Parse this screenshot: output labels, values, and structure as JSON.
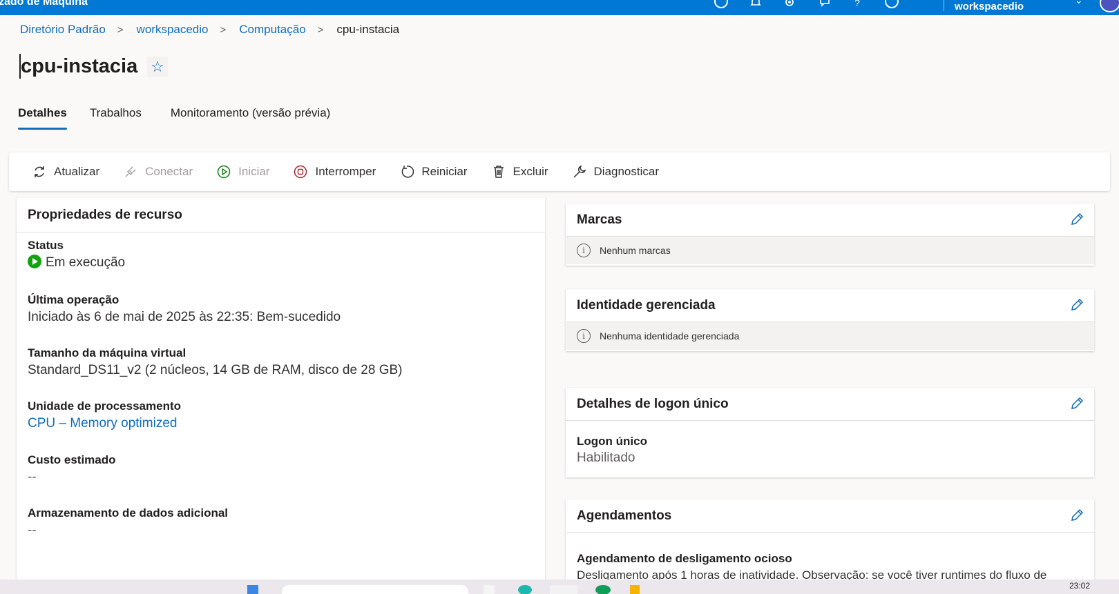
{
  "topbar": {
    "app_title": "zado de Máquina",
    "workspace": "workspacedio",
    "icons": [
      "help-circle-icon",
      "bell-icon",
      "gear-icon",
      "feedback-icon",
      "question-icon",
      "smiley-icon",
      "chevron-down-icon"
    ]
  },
  "breadcrumb": {
    "items": [
      "Diretório Padrão",
      "workspacedio",
      "Computação"
    ],
    "current": "cpu-instacia"
  },
  "page": {
    "title": "cpu-instacia"
  },
  "tabs": [
    "Detalhes",
    "Trabalhos",
    "Monitoramento (versão prévia)"
  ],
  "toolbar": {
    "refresh": "Atualizar",
    "connect": "Conectar",
    "start": "Iniciar",
    "stop": "Interromper",
    "restart": "Reiniciar",
    "delete": "Excluir",
    "diagnose": "Diagnosticar"
  },
  "properties": {
    "title": "Propriedades de recurso",
    "status_label": "Status",
    "status_value": "Em execução",
    "last_op_label": "Última operação",
    "last_op_value": "Iniciado às 6 de mai de 2025 às 22:35: Bem-sucedido",
    "vm_size_label": "Tamanho da máquina virtual",
    "vm_size_value": "Standard_DS11_v2 (2 núcleos, 14 GB de RAM, disco de 28 GB)",
    "processing_label": "Unidade de processamento",
    "processing_value": "CPU – Memory optimized",
    "cost_label": "Custo estimado",
    "cost_value": "--",
    "storage_label": "Armazenamento de dados adicional",
    "storage_value": "--"
  },
  "tags": {
    "title": "Marcas",
    "empty": "Nenhum marcas"
  },
  "identity": {
    "title": "Identidade gerenciada",
    "empty": "Nenhuma identidade gerenciada"
  },
  "sso": {
    "title": "Detalhes de logon único",
    "label": "Logon único",
    "value": "Habilitado"
  },
  "schedules": {
    "title": "Agendamentos",
    "idle_label": "Agendamento de desligamento ocioso",
    "idle_text": "Desligamento após 1 horas de inatividade. Observação: se você tiver runtimes do fluxo de"
  },
  "taskbar": {
    "clock": "23:02"
  },
  "colors": {
    "accent": "#0078d4",
    "link": "#0f6cbd",
    "running": "#13a10e",
    "stop": "#a4262c"
  }
}
